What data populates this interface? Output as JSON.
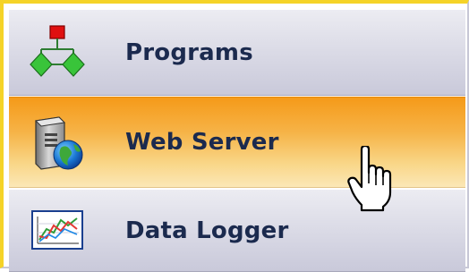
{
  "menu": {
    "items": [
      {
        "label": "Programs",
        "icon": "flowchart-icon",
        "active": false
      },
      {
        "label": "Web Server",
        "icon": "web-server-globe-icon",
        "active": true
      },
      {
        "label": "Data Logger",
        "icon": "chart-graph-icon",
        "active": false
      }
    ]
  },
  "colors": {
    "frame_accent": "#f5d327",
    "active_start": "#f59a19",
    "active_end": "#fbe7b6",
    "normal_start": "#ececf2",
    "normal_end": "#c9c9da",
    "label_color": "#1b2a4e"
  },
  "pointer": {
    "icon": "hand-pointer-icon"
  }
}
